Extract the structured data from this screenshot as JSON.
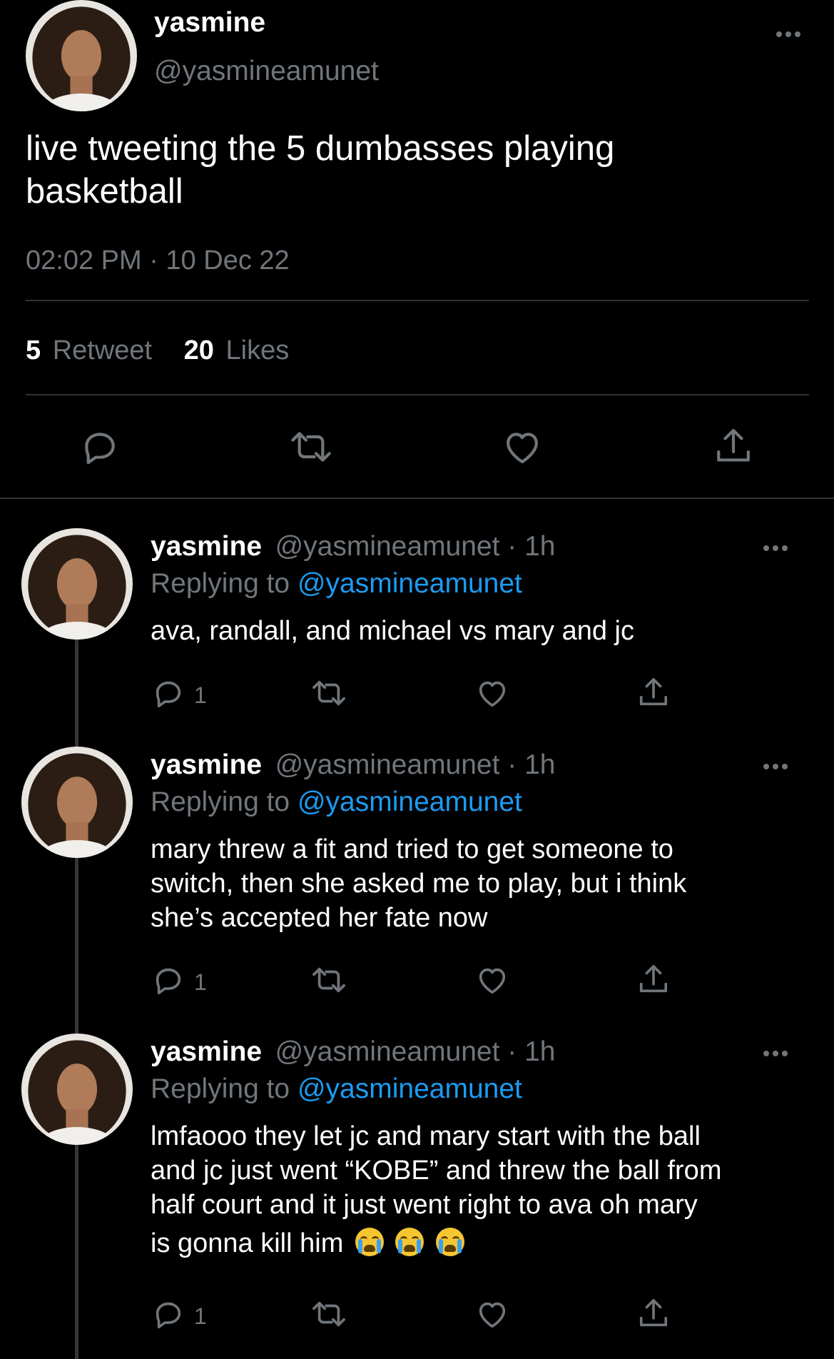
{
  "main_tweet": {
    "display_name": "yasmine",
    "handle": "@yasmineamunet",
    "text_line1": "live tweeting the 5 dumbasses playing",
    "text_line2": "basketball",
    "timestamp": "02:02 PM · 10 Dec 22",
    "retweet_count": "5",
    "retweet_label": "Retweet",
    "like_count": "20",
    "like_label": "Likes"
  },
  "replies": [
    {
      "display_name": "yasmine",
      "handle_time": "@yasmineamunet · 1h",
      "replying_prefix": "Replying to",
      "replying_handle": "@yasmineamunet",
      "lines": [
        "ava, randall, and michael vs mary and jc"
      ],
      "reply_count": "1"
    },
    {
      "display_name": "yasmine",
      "handle_time": "@yasmineamunet · 1h",
      "replying_prefix": "Replying to",
      "replying_handle": "@yasmineamunet",
      "lines": [
        "mary threw a fit and tried to get someone to",
        "switch, then she asked me to play, but i think",
        "she’s accepted her fate now"
      ],
      "reply_count": "1"
    },
    {
      "display_name": "yasmine",
      "handle_time": "@yasmineamunet · 1h",
      "replying_prefix": "Replying to",
      "replying_handle": "@yasmineamunet",
      "lines": [
        "lmfaooo they let jc and mary start with the ball",
        "and jc just went “KOBE” and threw the ball from",
        "half court and it just went right to ava oh mary",
        "is gonna kill him"
      ],
      "emoji": "loudly-crying-face",
      "reply_count": "1"
    }
  ],
  "icons": {
    "reply": "reply-bubble-icon",
    "retweet": "retweet-icon",
    "like": "heart-icon",
    "share": "share-icon",
    "more": "more-icon"
  },
  "colors": {
    "background": "#000000",
    "secondary_text": "#71767b",
    "link": "#1d9bf0",
    "divider": "#2f3336"
  }
}
